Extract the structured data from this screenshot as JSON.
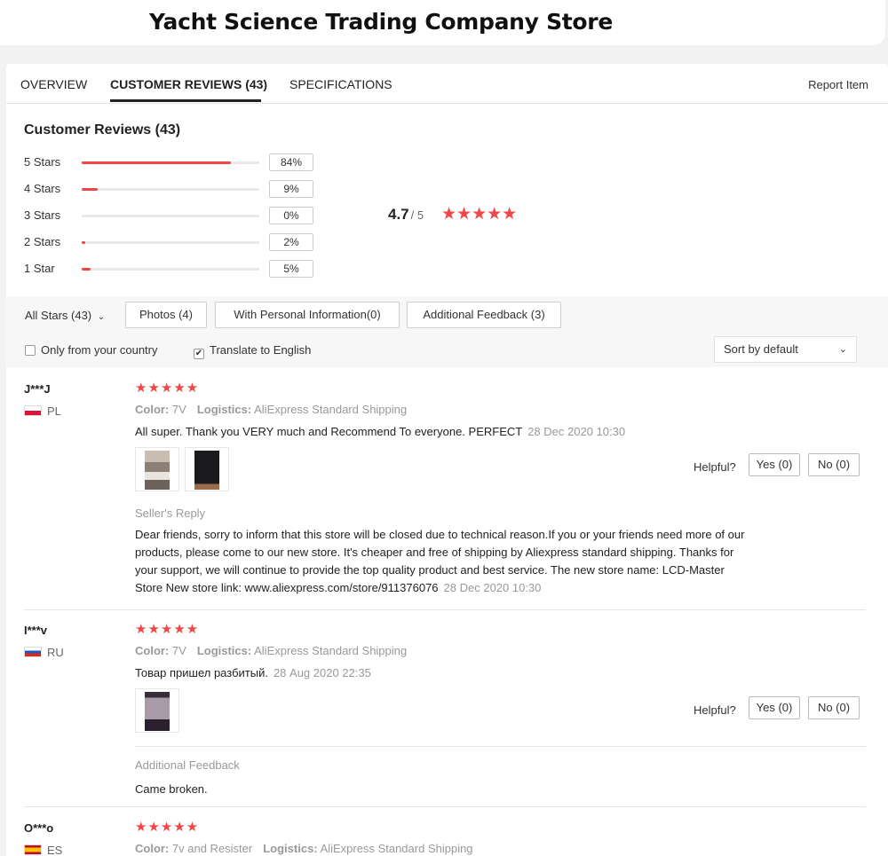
{
  "store": {
    "title": "Yacht Science Trading Company Store"
  },
  "tabs": [
    {
      "label": "OVERVIEW"
    },
    {
      "label": "CUSTOMER REVIEWS (43)"
    },
    {
      "label": "SPECIFICATIONS"
    }
  ],
  "report_label": "Report Item",
  "summary": {
    "title": "Customer Reviews (43)",
    "rows": [
      {
        "label": "5 Stars",
        "pct_text": "84%",
        "pct": 84
      },
      {
        "label": "4 Stars",
        "pct_text": "9%",
        "pct": 9
      },
      {
        "label": "3 Stars",
        "pct_text": "0%",
        "pct": 0
      },
      {
        "label": "2 Stars",
        "pct_text": "2%",
        "pct": 2
      },
      {
        "label": "1 Star",
        "pct_text": "5%",
        "pct": 5
      }
    ],
    "average": "4.7",
    "out_of": "/ 5",
    "stars": "★★★★★"
  },
  "filters": {
    "all_stars": "All Stars (43)",
    "photos": "Photos (4)",
    "personal": "With Personal Information(0)",
    "additional": "Additional Feedback (3)",
    "only_country": "Only from your country",
    "translate": "Translate to English",
    "sort": "Sort by default"
  },
  "reviews": [
    {
      "name": "J***J",
      "country": "PL",
      "stars": "★★★★★",
      "color_label": "Color:",
      "color": "7V",
      "logistics_label": "Logistics:",
      "logistics": "AliExpress Standard Shipping",
      "text": "All super. Thank you VERY much and Recommend To everyone. PERFECT",
      "date": "28 Dec 2020 10:30",
      "helpful": "Helpful?",
      "yes": "Yes (0)",
      "no": "No (0)",
      "reply_title": "Seller's Reply",
      "reply": "Dear friends, sorry to inform that this store will be closed due to technical reason.If you or your friends need more of our products, please come to our new store. It's cheaper and free of shipping by Aliexpress standard shipping. Thanks for your support, we will continue to provide the top quality product and best service. The new store name: LCD-Master Store New store link: www.aliexpress.com/store/911376076",
      "reply_date": "28 Dec 2020 10:30"
    },
    {
      "name": "I***v",
      "country": "RU",
      "stars": "★★★★★",
      "color_label": "Color:",
      "color": "7V",
      "logistics_label": "Logistics:",
      "logistics": "AliExpress Standard Shipping",
      "text": "Товар пришел разбитый.",
      "date": "28 Aug 2020 22:35",
      "helpful": "Helpful?",
      "yes": "Yes (0)",
      "no": "No (0)",
      "feedback_title": "Additional Feedback",
      "feedback": "Came broken."
    },
    {
      "name": "O***o",
      "country": "ES",
      "stars": "★★★★★",
      "color_label": "Color:",
      "color": "7v and Resister",
      "logistics_label": "Logistics:",
      "logistics": "AliExpress Standard Shipping"
    }
  ],
  "colors": {
    "accent": "#f04646",
    "muted": "#999999"
  }
}
